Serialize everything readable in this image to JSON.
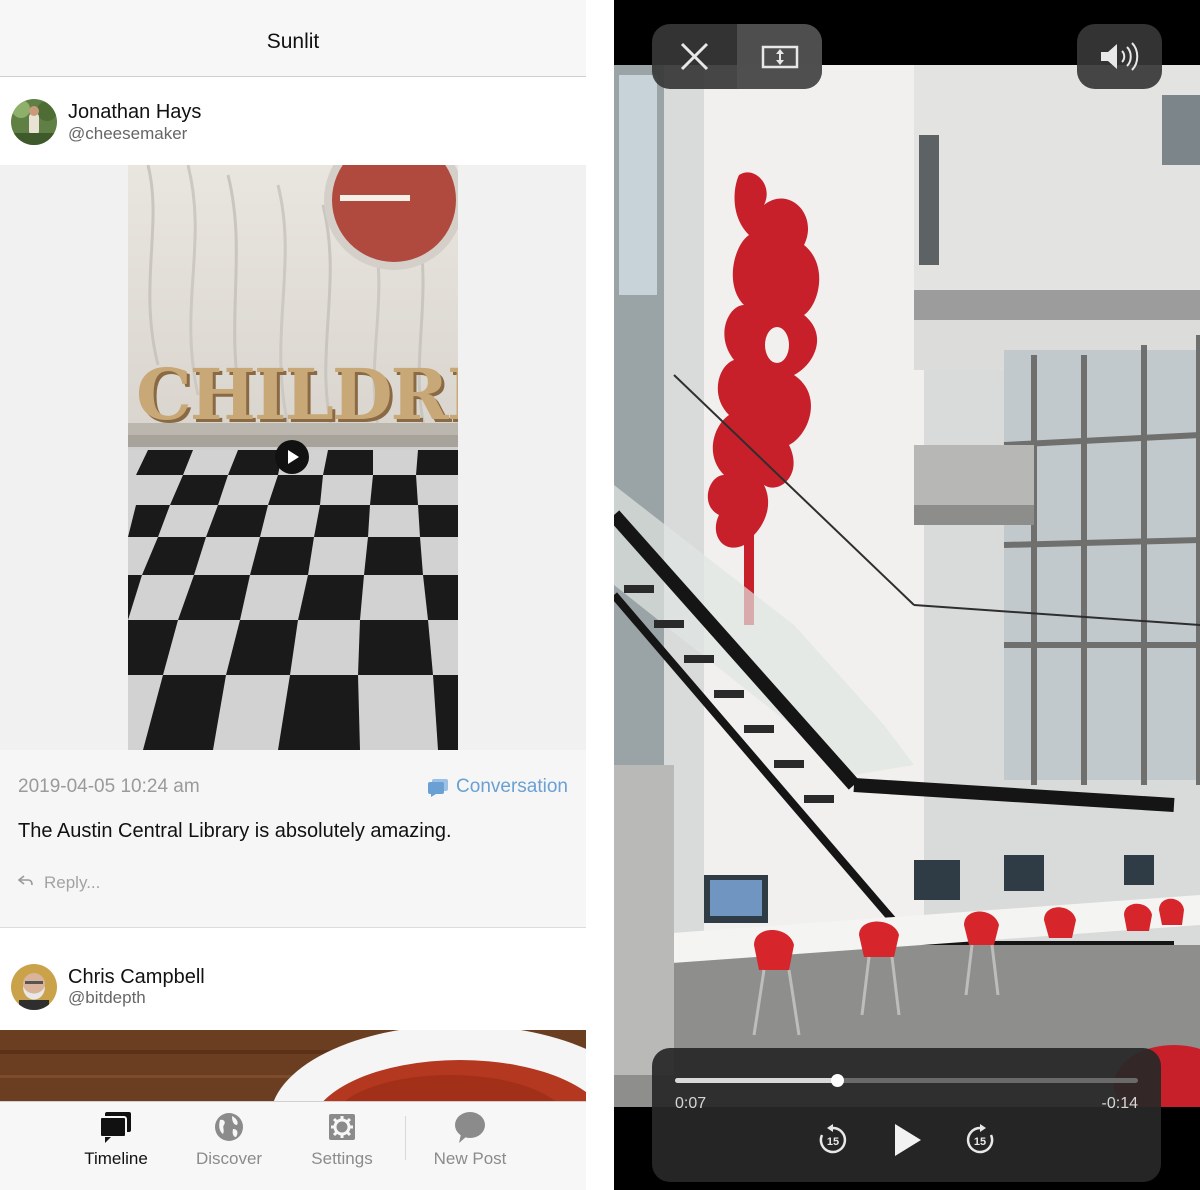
{
  "app": {
    "title": "Sunlit"
  },
  "posts": [
    {
      "author": "Jonathan Hays",
      "handle": "@cheesemaker",
      "date": "2019-04-05 10:24 am",
      "conversation_label": "Conversation",
      "text": "The Austin Central Library is absolutely amazing.",
      "reply_placeholder": "Reply...",
      "media_letters": "CHILDRE"
    },
    {
      "author": "Chris Campbell",
      "handle": "@bitdepth"
    }
  ],
  "tabs": [
    {
      "label": "Timeline",
      "icon": "timeline-icon",
      "active": true
    },
    {
      "label": "Discover",
      "icon": "globe-icon"
    },
    {
      "label": "Settings",
      "icon": "gear-icon"
    },
    {
      "label": "New Post",
      "icon": "speech-bubble-icon"
    }
  ],
  "player": {
    "elapsed": "0:07",
    "remaining": "-0:14",
    "progress_fraction": 0.35,
    "skip_back_seconds": "15",
    "skip_forward_seconds": "15"
  },
  "colors": {
    "accent": "#6aa0d4",
    "sculpture_red": "#c8202a"
  }
}
